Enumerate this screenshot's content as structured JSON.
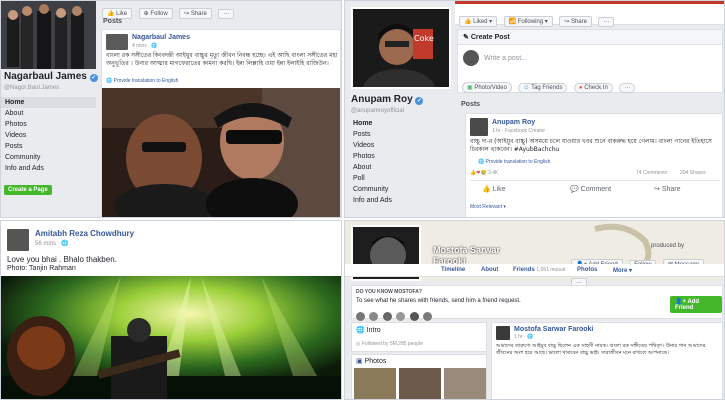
{
  "panel1": {
    "page_name": "Nagarbaul James",
    "handle": "@Nagor.Baul.James",
    "nav": [
      "Home",
      "About",
      "Photos",
      "Videos",
      "Posts",
      "Community",
      "Info and Ads"
    ],
    "create_page": "Create a Page",
    "actions": [
      "Like",
      "Follow",
      "Share"
    ],
    "posts_header": "Posts",
    "post_author": "Nagarbaul James",
    "post_time": "4 mins",
    "post_text": "বাংলা রক সঙ্গীতের কিংবদন্তী আইয়ুব বাচ্চুর মৃত্যু জীবন নিবন্ধ হচ্ছে। এই আছি বাংলা সঙ্গীতের মহা অনুভূতির । উনার আত্মার মাগফেরাতের কামনা করছি। ইন্না লিল্লাহি ওয়া ইন্না ইলাইহি রাজিউন।",
    "translate": "Provide translation to English"
  },
  "panel2": {
    "page_name": "Anupam Roy",
    "handle": "@anupamroyofficial",
    "nav": [
      "Home",
      "Posts",
      "Videos",
      "Photos",
      "About",
      "Poll",
      "Community",
      "Info and Ads"
    ],
    "top_actions": [
      "Liked",
      "Following",
      "Share"
    ],
    "create_post": "Create Post",
    "write_placeholder": "Write a post...",
    "post_options": [
      "Photo/Video",
      "Tag Friends",
      "Check In"
    ],
    "posts_header": "Posts",
    "post_author": "Anupam Roy",
    "post_meta": "1 hr · Facebook Creator",
    "post_text": "বাচ্চু দা-র (আইয়ুব বাচ্চু) অসময়ে চলে যাওয়ার খবর শুনে বাকরুদ্ধ হয়ে গেলাম। বাংলা গানের ইতিহাসে চিরকাল থাকবেন। #AyubBachchu",
    "hashtag": "#AyubBachchu",
    "translate": "Provide translation to English",
    "reactions": "3.4K",
    "comments": "74 Comments",
    "shares": "204 Shares",
    "buttons": [
      "Like",
      "Comment",
      "Share"
    ],
    "most_relevant": "Most Relevant"
  },
  "panel3": {
    "author": "Amitabh Reza Chowdhury",
    "time": "56 mins",
    "text": "Love you bhai . Bhalo thakben.",
    "photo_credit": "Photo: Tanjin Rahman"
  },
  "panel4": {
    "profile_name": "Mostofa Sarwar Farooki",
    "produced_by": "produced by",
    "buttons": [
      "Add Friend",
      "Follow",
      "Message"
    ],
    "tabs": [
      "Timeline",
      "About",
      "Friends",
      "Photos",
      "More"
    ],
    "friends_count": "1,651 mutual",
    "know_prompt": "DO YOU KNOW MOSTOFA?",
    "know_text": "To see what he shares with friends, send him a friend request.",
    "add_friend": "Add Friend",
    "intro": "Intro",
    "followed_by": "Followed by 5M,285 people",
    "photos": "Photos",
    "post_author": "Mostofa Sarwar Farooki",
    "post_time": "1 hr",
    "post_text": "আমাদের তারুণ্যে আইয়ুব বাচ্চু ছিলেন এক সাহসী নায়ক। বাংলা রক সঙ্গীতের পথিকৃৎ। উনার গান আমাদের জীবনের অংশ হয়ে আছে। ভালো থাকবেন বাচ্চু ভাই। সারাজীবন মনে রাখবো আপনাকে।"
  }
}
